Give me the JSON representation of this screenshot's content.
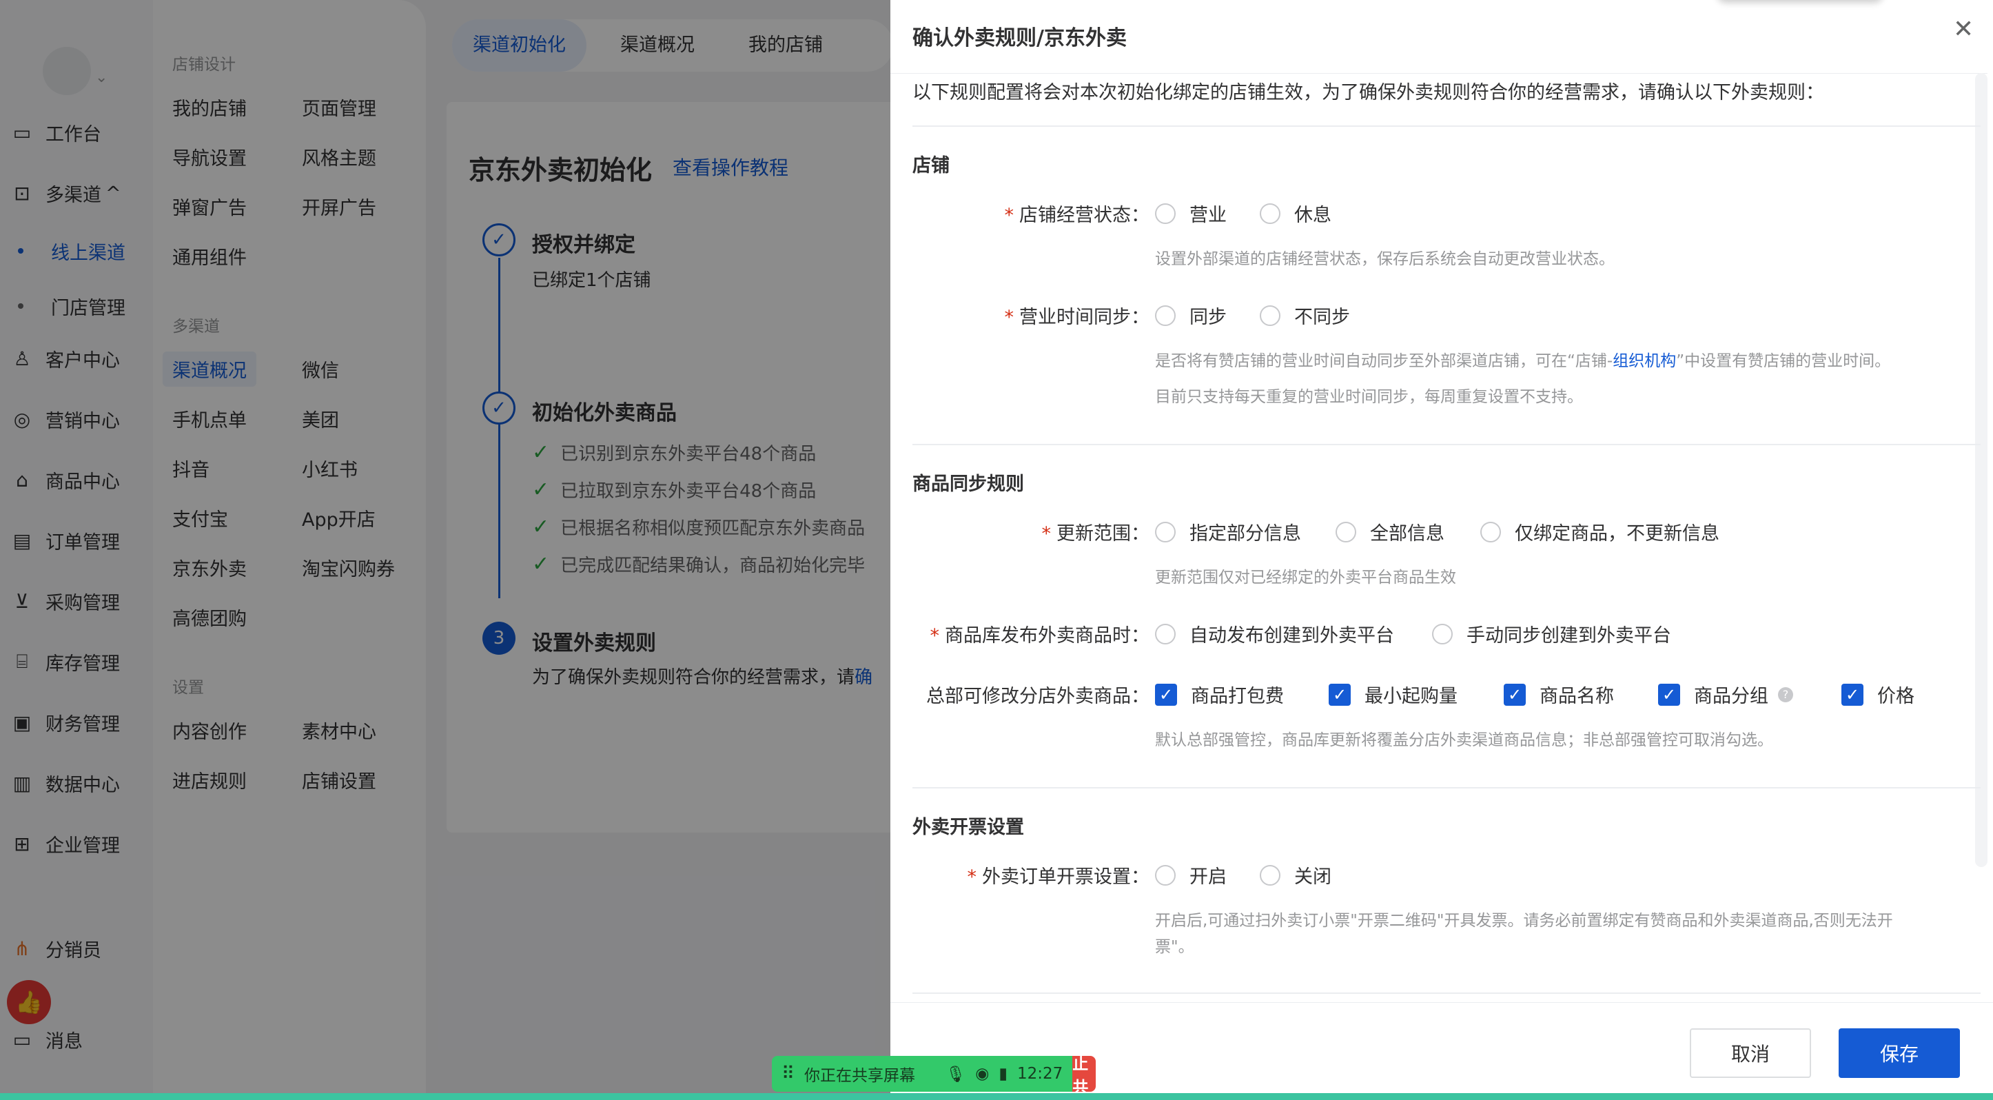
{
  "nav_primary": {
    "items": [
      {
        "label": "工作台",
        "icon": "dashboard-icon"
      },
      {
        "label": "多渠道",
        "icon": "multichannel-icon",
        "expanded_indicator": "^"
      },
      {
        "label": "线上渠道"
      },
      {
        "label": "门店管理"
      },
      {
        "label": "客户中心",
        "icon": "user-icon"
      },
      {
        "label": "营销中心",
        "icon": "marketing-icon"
      },
      {
        "label": "商品中心",
        "icon": "bag-icon"
      },
      {
        "label": "订单管理",
        "icon": "order-icon"
      },
      {
        "label": "采购管理",
        "icon": "cart-icon"
      },
      {
        "label": "库存管理",
        "icon": "warehouse-icon"
      },
      {
        "label": "财务管理",
        "icon": "finance-icon"
      },
      {
        "label": "数据中心",
        "icon": "chart-icon"
      },
      {
        "label": "企业管理",
        "icon": "bank-icon"
      },
      {
        "label": "分销员",
        "icon": "distributor-icon"
      },
      {
        "label": "消息",
        "icon": "message-icon"
      }
    ]
  },
  "nav_secondary": {
    "store_design_heading": "店铺设计",
    "store_design": [
      "我的店铺",
      "页面管理",
      "导航设置",
      "风格主题",
      "弹窗广告",
      "开屏广告",
      "通用组件"
    ],
    "multichannel_heading": "多渠道",
    "multichannel": [
      "渠道概况",
      "微信",
      "手机点单",
      "美团",
      "抖音",
      "小红书",
      "支付宝",
      "App开店",
      "京东外卖",
      "淘宝闪购券",
      "高德团购"
    ],
    "settings_heading": "设置",
    "settings": [
      "内容创作",
      "素材中心",
      "进店规则",
      "店铺设置"
    ]
  },
  "tabs": [
    "渠道初始化",
    "渠道概况",
    "我的店铺"
  ],
  "page": {
    "title": "京东外卖初始化",
    "tutorial_link": "查看操作教程",
    "step1_title": "授权并绑定",
    "step1_sub": "已绑定1个店铺",
    "step2_title": "初始化外卖商品",
    "step2_items": [
      "已识别到京东外卖平台48个商品",
      "已拉取到京东外卖平台48个商品",
      "已根据名称相似度预匹配京东外卖商品",
      "已完成匹配结果确认，商品初始化完毕"
    ],
    "step3_num": "3",
    "step3_title": "设置外卖规则",
    "step3_sub": "为了确保外卖规则符合你的经营需求，请",
    "step3_sub_link": "确"
  },
  "drawer": {
    "title": "确认外卖规则/京东外卖",
    "close_icon": "close-icon",
    "intro": "以下规则配置将会对本次初始化绑定的店铺生效，为了确保外卖规则符合你的经营需求，请确认以下外卖规则：",
    "store": {
      "heading": "店铺",
      "status_label": "店铺经营状态：",
      "status_options": [
        "营业",
        "休息"
      ],
      "status_help": "设置外部渠道的店铺经营状态，保存后系统会自动更改营业状态。",
      "hours_label": "营业时间同步：",
      "hours_options": [
        "同步",
        "不同步"
      ],
      "hours_help_pre": "是否将有赞店铺的营业时间自动同步至外部渠道店铺，可在“店铺-",
      "hours_help_link": "组织机构",
      "hours_help_post": "”中设置有赞店铺的营业时间。",
      "hours_help2": "目前只支持每天重复的营业时间同步，每周重复设置不支持。"
    },
    "goods": {
      "heading": "商品同步规则",
      "range_label": "更新范围：",
      "range_options": [
        "指定部分信息",
        "全部信息",
        "仅绑定商品，不更新信息"
      ],
      "range_help": "更新范围仅对已经绑定的外卖平台商品生效",
      "publish_label": "商品库发布外卖商品时：",
      "publish_options": [
        "自动发布创建到外卖平台",
        "手动同步创建到外卖平台"
      ],
      "hq_label": "总部可修改分店外卖商品：",
      "hq_options": [
        "商品打包费",
        "最小起购量",
        "商品名称",
        "商品分组",
        "价格"
      ],
      "hq_help": "默认总部强管控，商品库更新将覆盖分店外卖渠道商品信息；非总部强管控可取消勾选。"
    },
    "invoice": {
      "heading": "外卖开票设置",
      "label": "外卖订单开票设置：",
      "options": [
        "开启",
        "关闭"
      ],
      "help1": "开启后,可通过扫外卖订小票\"开票二维码\"开具发票。请务必前置绑定有赞商品和外卖渠道商品,否则无法开",
      "help2": "票\"。"
    },
    "cancel_label": "取消",
    "save_label": "保存"
  },
  "share_bar": {
    "text": "你正在共享屏幕",
    "time": "12:27",
    "stop_label": "停止共享"
  },
  "colors": {
    "accent": "#155bd4",
    "required": "#d42f15",
    "check_green": "#2da641",
    "share_green": "#33c96a",
    "stop_red": "#e5483e"
  }
}
